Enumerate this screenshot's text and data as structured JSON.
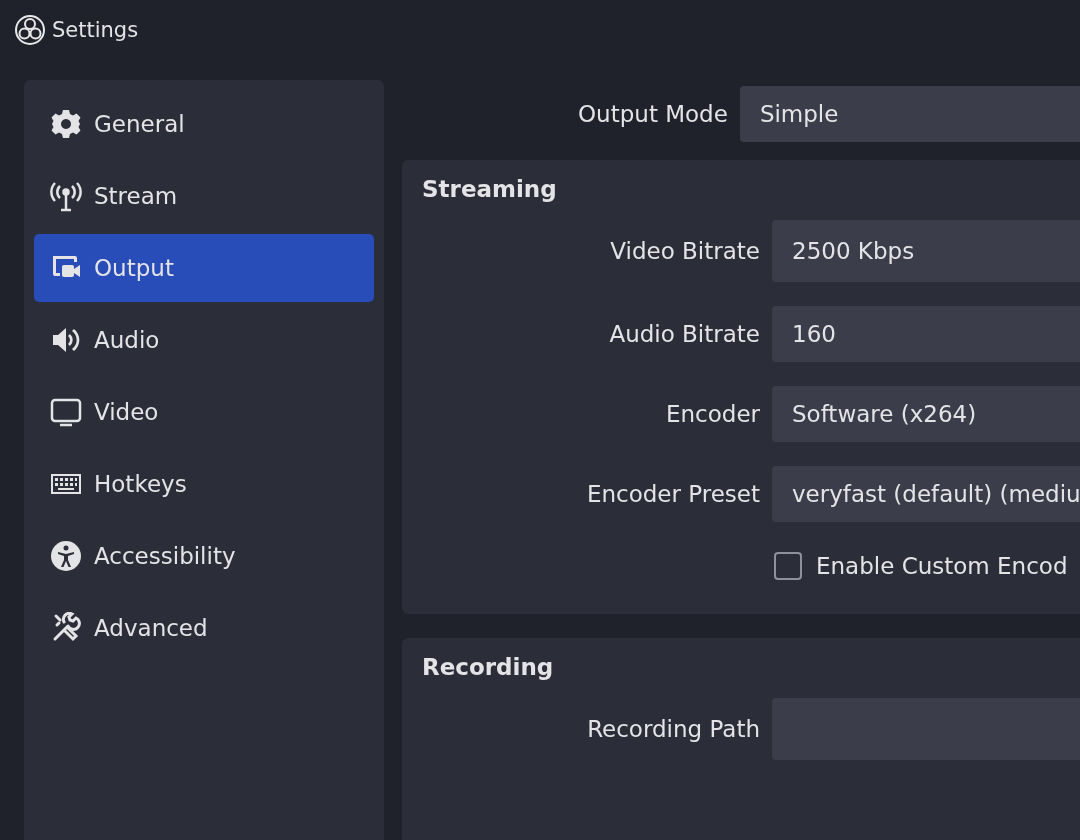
{
  "window": {
    "title": "Settings"
  },
  "sidebar": {
    "items": [
      {
        "label": "General",
        "selected": false
      },
      {
        "label": "Stream",
        "selected": false
      },
      {
        "label": "Output",
        "selected": true
      },
      {
        "label": "Audio",
        "selected": false
      },
      {
        "label": "Video",
        "selected": false
      },
      {
        "label": "Hotkeys",
        "selected": false
      },
      {
        "label": "Accessibility",
        "selected": false
      },
      {
        "label": "Advanced",
        "selected": false
      }
    ]
  },
  "output_mode": {
    "label": "Output Mode",
    "value": "Simple"
  },
  "streaming": {
    "title": "Streaming",
    "fields": [
      {
        "label": "Video Bitrate",
        "value": "2500 Kbps"
      },
      {
        "label": "Audio Bitrate",
        "value": "160"
      },
      {
        "label": "Encoder",
        "value": "Software (x264)"
      },
      {
        "label": "Encoder Preset",
        "value": "veryfast (default) (mediu"
      }
    ],
    "checkbox": {
      "label": "Enable Custom Encod",
      "checked": false
    }
  },
  "recording": {
    "title": "Recording",
    "fields": [
      {
        "label": "Recording Path"
      }
    ]
  }
}
